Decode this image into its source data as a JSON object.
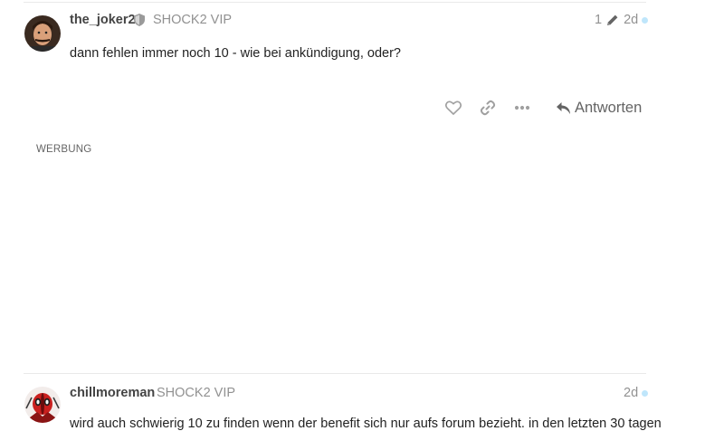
{
  "post1": {
    "username": "the_joker2",
    "user_title": "SHOCK2 VIP",
    "edit_count": "1",
    "time": "2d",
    "body": "dann fehlen immer noch 10 - wie bei ankündigung, oder?",
    "reply_label": "Antworten"
  },
  "ad": {
    "label": "WERBUNG"
  },
  "post2": {
    "username": "chillmoreman",
    "user_title": "SHOCK2 VIP",
    "time": "2d",
    "body": "wird auch schwierig 10 zu finden wenn der benefit sich nur aufs forum bezieht. in den letzten 30 tagen"
  },
  "colors": {
    "text": "#222222",
    "muted": "#919191",
    "username": "#444444",
    "unread_dot": "#bfe6fb",
    "divider": "#e9e9e9"
  }
}
